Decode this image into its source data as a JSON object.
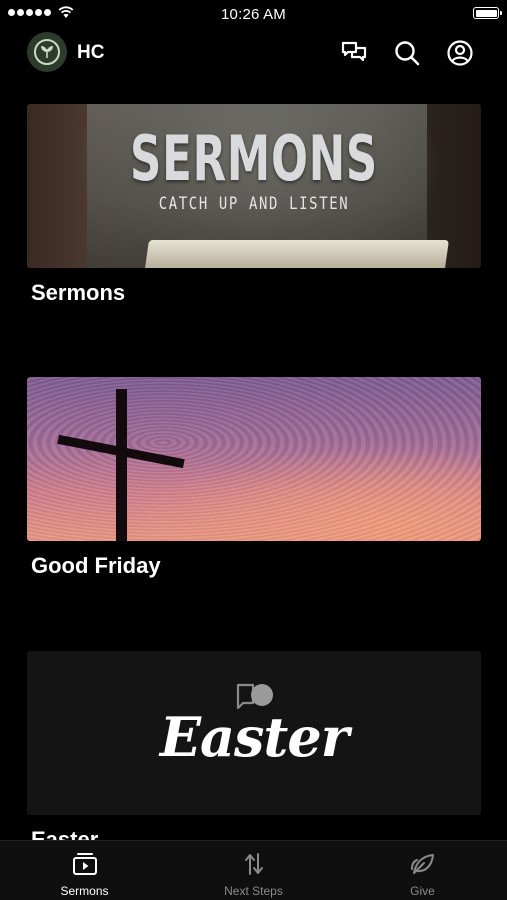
{
  "status_bar": {
    "time": "10:26 AM"
  },
  "header": {
    "org_name": "HC"
  },
  "cards": [
    {
      "title": "Sermons",
      "image_heading": "SERMONS",
      "image_subheading": "CATCH UP AND LISTEN"
    },
    {
      "title": "Good Friday"
    },
    {
      "title": "Easter",
      "image_heading": "Easter"
    }
  ],
  "tabs": [
    {
      "label": "Sermons",
      "icon": "play-box-icon",
      "active": true
    },
    {
      "label": "Next Steps",
      "icon": "arrows-up-down-icon",
      "active": false
    },
    {
      "label": "Give",
      "icon": "leaf-icon",
      "active": false
    }
  ],
  "colors": {
    "background": "#000000",
    "tab_active": "#ffffff",
    "tab_inactive": "#8a8a8a"
  }
}
